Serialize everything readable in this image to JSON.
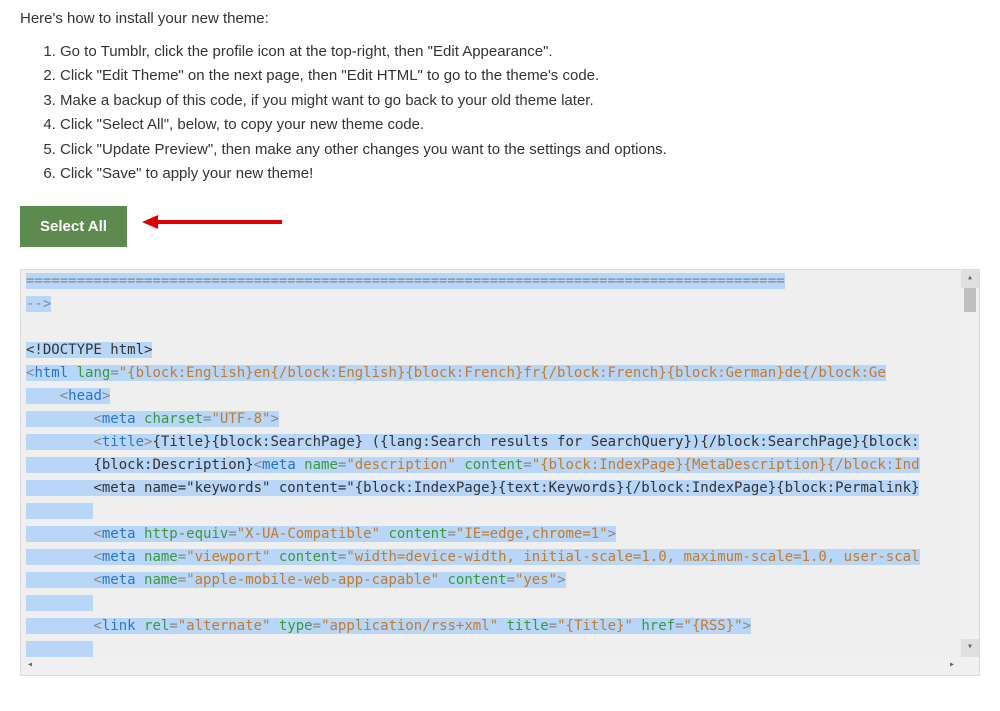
{
  "intro": "Here's how to install your new theme:",
  "steps": [
    "Go to Tumblr, click the profile icon at the top-right, then \"Edit Appearance\".",
    "Click \"Edit Theme\" on the next page, then \"Edit HTML\" to go to the theme's code.",
    "Make a backup of this code, if you might want to go back to your old theme later.",
    "Click \"Select All\", below, to copy your new theme code.",
    "Click \"Update Preview\", then make any other changes you want to the settings and options.",
    "Click \"Save\" to apply your new theme!"
  ],
  "select_all_label": "Select All",
  "code": {
    "line_sep": "==========================================================================================",
    "end_comment": "-->",
    "doctype": "<!DOCTYPE html>",
    "html_open_a": "<",
    "html_open_b": "html",
    "html_open_c": " lang",
    "html_open_d": "=",
    "html_open_e": "\"{block:English}en{/block:English}{block:French}fr{/block:French}{block:German}de{/block:Ge",
    "head_open": "<head>",
    "meta_charset_a": "<",
    "meta_charset_b": "meta",
    "meta_charset_c": " charset",
    "meta_charset_d": "=",
    "meta_charset_e": "\"UTF-8\"",
    "meta_charset_f": ">",
    "title_a": "<",
    "title_b": "title",
    "title_c": ">",
    "title_d": "{Title}{block:SearchPage} ({lang:Search results for SearchQuery}){/block:SearchPage}{block:",
    "desc_a": "{block:Description}",
    "desc_b": "<",
    "desc_c": "meta",
    "desc_d": " name",
    "desc_e": "=",
    "desc_f": "\"description\"",
    "desc_g": " content",
    "desc_h": "=",
    "desc_i": "\"{block:IndexPage}{MetaDescription}{/block:Ind",
    "kw": "<meta name=\"keywords\" content=\"{block:IndexPage}{text:Keywords}{/block:IndexPage}{block:Permalink}",
    "compat_a": "<",
    "compat_b": "meta",
    "compat_c": " http-equiv",
    "compat_d": "=",
    "compat_e": "\"X-UA-Compatible\"",
    "compat_f": " content",
    "compat_g": "=",
    "compat_h": "\"IE=edge,chrome=1\"",
    "compat_i": ">",
    "vp_a": "<",
    "vp_b": "meta",
    "vp_c": " name",
    "vp_d": "=",
    "vp_e": "\"viewport\"",
    "vp_f": " content",
    "vp_g": "=",
    "vp_h": "\"width=device-width, initial-scale=1.0, maximum-scale=1.0, user-scal",
    "apple_a": "<",
    "apple_b": "meta",
    "apple_c": " name",
    "apple_d": "=",
    "apple_e": "\"apple-mobile-web-app-capable\"",
    "apple_f": " content",
    "apple_g": "=",
    "apple_h": "\"yes\"",
    "apple_i": ">",
    "link_a": "<",
    "link_b": "link",
    "link_c": " rel",
    "link_d": "=",
    "link_e": "\"alternate\"",
    "link_f": " type",
    "link_g": "=",
    "link_h": "\"application/rss+xml\"",
    "link_i": " title",
    "link_j": "=",
    "link_k": "\"{Title}\"",
    "link_l": " href",
    "link_m": "=",
    "link_n": "\"{RSS}\"",
    "link_o": ">"
  }
}
